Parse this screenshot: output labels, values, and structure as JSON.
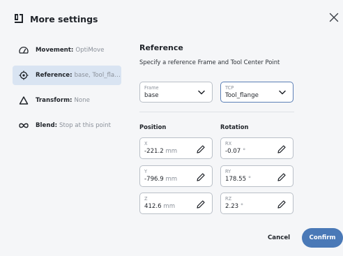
{
  "dialog": {
    "title": "More settings",
    "logo_icon": "ur-logo-icon",
    "close_icon": "close-icon"
  },
  "sidebar": {
    "items": [
      {
        "key": "Movement:",
        "value": "OptiMove",
        "icon": "gauge-icon",
        "active": false
      },
      {
        "key": "Reference:",
        "value": "base, Tool_flan...",
        "icon": "target-icon",
        "active": true
      },
      {
        "key": "Transform:",
        "value": "None",
        "icon": "delta-icon",
        "active": false
      },
      {
        "key": "Blend:",
        "value": "Stop at this point",
        "icon": "infinity-icon",
        "active": false
      }
    ]
  },
  "reference": {
    "title": "Reference",
    "description": "Specify a reference Frame and Tool Center Point",
    "frame": {
      "label": "Frame",
      "value": "base"
    },
    "tcp": {
      "label": "TCP",
      "value": "Tool_flange"
    }
  },
  "position": {
    "heading": "Position",
    "x": {
      "label": "X",
      "value": "-221.2",
      "unit": "mm"
    },
    "y": {
      "label": "Y",
      "value": "-796.9",
      "unit": "mm"
    },
    "z": {
      "label": "Z",
      "value": "412.6",
      "unit": "mm"
    }
  },
  "rotation": {
    "heading": "Rotation",
    "rx": {
      "label": "RX",
      "value": "-0.07",
      "unit": "°"
    },
    "ry": {
      "label": "RY",
      "value": "178.55",
      "unit": "°"
    },
    "rz": {
      "label": "RZ",
      "value": "2.23",
      "unit": "°"
    }
  },
  "footer": {
    "cancel_label": "Cancel",
    "confirm_label": "Confirm"
  },
  "colors": {
    "accent": "#4a79b7",
    "active_item_bg": "#d9e4f2",
    "dialog_bg": "#f5f6f8"
  }
}
